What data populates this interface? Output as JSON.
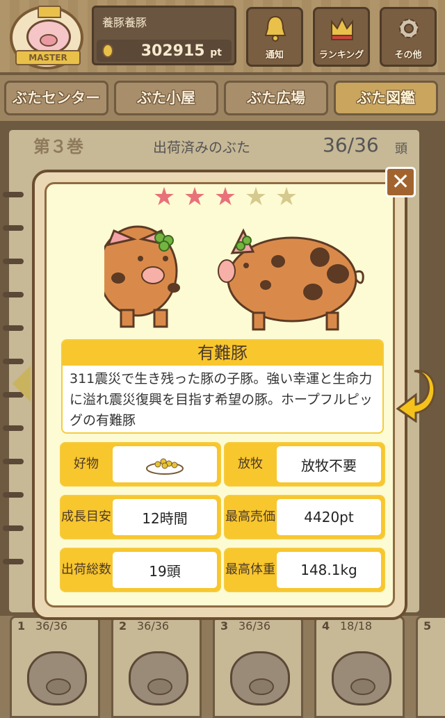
{
  "header": {
    "badge_text": "MASTER",
    "username": "養豚養豚",
    "points": "302915",
    "points_unit": "pt",
    "buttons": [
      {
        "label": "通知",
        "icon": "bell-icon"
      },
      {
        "label": "ランキング",
        "icon": "crown-icon"
      },
      {
        "label": "その他",
        "icon": "gear-icon"
      }
    ]
  },
  "tabs": [
    {
      "label": "ぶたセンター",
      "active": false
    },
    {
      "label": "ぶた小屋",
      "active": false
    },
    {
      "label": "ぶた広場",
      "active": false
    },
    {
      "label": "ぶた図鑑",
      "active": true
    }
  ],
  "book": {
    "volume": "第３巻",
    "shipped_label": "出荷済みのぶた",
    "shipped_count": "36/36",
    "shipped_unit": "頭"
  },
  "modal": {
    "rating": 3,
    "rating_max": 5,
    "star_glyph": "★",
    "colors": {
      "star_on": "#e8717a",
      "star_off": "#d6c98e",
      "accent": "#f8c62d",
      "pig_body": "#d98a4a",
      "pig_spots": "#5c3a24"
    },
    "name": "有難豚",
    "description": "311震災で生き残った豚の子豚。強い幸運と生命力に溢れ震災復興を目指す希望の豚。ホープフルピッグの有難豚",
    "stats": {
      "favorite_food_label": "好物",
      "favorite_food_icon": "food-bowl-icon",
      "grazing_label": "放牧",
      "grazing_value": "放牧不要",
      "growth_label_1": "成長",
      "growth_label_2": "目安",
      "growth_value": "12時間",
      "max_price_label_1": "最高",
      "max_price_label_2": "売価",
      "max_price_value": "4420pt",
      "shipped_label_1": "出荷",
      "shipped_label_2": "総数",
      "shipped_value": "19頭",
      "max_weight_label_1": "最高",
      "max_weight_label_2": "体重",
      "max_weight_value": "148.1kg"
    },
    "close_glyph": "✕"
  },
  "bottom_cards": [
    {
      "number": "1",
      "count": "36/36"
    },
    {
      "number": "2",
      "count": "36/36"
    },
    {
      "number": "3",
      "count": "36/36"
    },
    {
      "number": "4",
      "count": "18/18"
    },
    {
      "number": "5",
      "count": ""
    }
  ]
}
